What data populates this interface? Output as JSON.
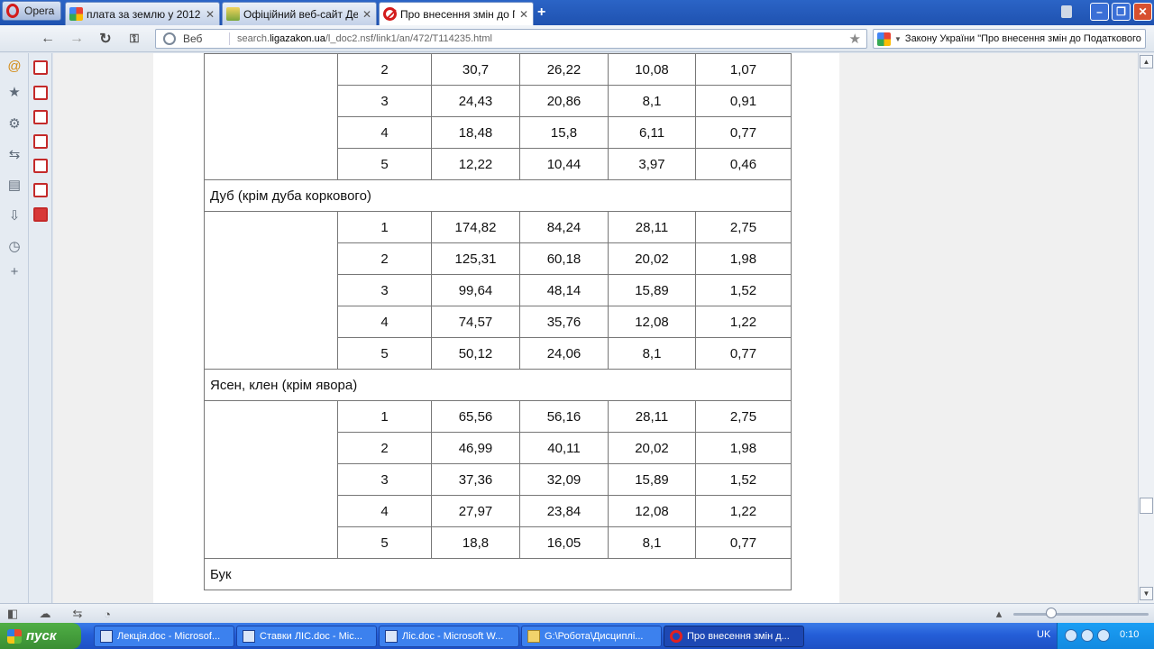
{
  "browser": {
    "menu_label": "Opera",
    "tabs": [
      {
        "label": "плата за землю у 2012 ...",
        "active": false,
        "icon": "google-favicon"
      },
      {
        "label": "Офіційний веб-сайт Де...",
        "active": false,
        "icon": "crest-favicon"
      },
      {
        "label": "Про внесення змін до П...",
        "active": true,
        "icon": "ban-favicon"
      }
    ],
    "new_tab": "+",
    "address": {
      "scheme_label": "Веб",
      "url_prefix": "search.",
      "url_domain": "ligazakon.ua",
      "url_path": "/l_doc2.nsf/link1/an/472/T114235.html"
    },
    "search_text": "Закону України \"Про внесення змін до Податкового"
  },
  "table": {
    "rows": [
      {
        "kind": "data",
        "cells": [
          "2",
          "30,7",
          "26,22",
          "10,08",
          "1,07"
        ]
      },
      {
        "kind": "data",
        "cells": [
          "3",
          "24,43",
          "20,86",
          "8,1",
          "0,91"
        ]
      },
      {
        "kind": "data",
        "cells": [
          "4",
          "18,48",
          "15,8",
          "6,11",
          "0,77"
        ]
      },
      {
        "kind": "data",
        "cells": [
          "5",
          "12,22",
          "10,44",
          "3,97",
          "0,46"
        ]
      },
      {
        "kind": "species",
        "label": "Дуб (крім дуба коркового)"
      },
      {
        "kind": "data",
        "cells": [
          "1",
          "174,82",
          "84,24",
          "28,11",
          "2,75"
        ]
      },
      {
        "kind": "data",
        "cells": [
          "2",
          "125,31",
          "60,18",
          "20,02",
          "1,98"
        ]
      },
      {
        "kind": "data",
        "cells": [
          "3",
          "99,64",
          "48,14",
          "15,89",
          "1,52"
        ]
      },
      {
        "kind": "data",
        "cells": [
          "4",
          "74,57",
          "35,76",
          "12,08",
          "1,22"
        ]
      },
      {
        "kind": "data",
        "cells": [
          "5",
          "50,12",
          "24,06",
          "8,1",
          "0,77"
        ]
      },
      {
        "kind": "species",
        "label": "Ясен, клен (крім явора)"
      },
      {
        "kind": "data",
        "cells": [
          "1",
          "65,56",
          "56,16",
          "28,11",
          "2,75"
        ]
      },
      {
        "kind": "data",
        "cells": [
          "2",
          "46,99",
          "40,11",
          "20,02",
          "1,98"
        ]
      },
      {
        "kind": "data",
        "cells": [
          "3",
          "37,36",
          "32,09",
          "15,89",
          "1,52"
        ]
      },
      {
        "kind": "data",
        "cells": [
          "4",
          "27,97",
          "23,84",
          "12,08",
          "1,22"
        ]
      },
      {
        "kind": "data",
        "cells": [
          "5",
          "18,8",
          "16,05",
          "8,1",
          "0,77"
        ]
      },
      {
        "kind": "species",
        "label": "Бук"
      }
    ]
  },
  "taskbar": {
    "start_label": "пуск",
    "tasks": [
      {
        "label": "Лекція.doc - Microsof...",
        "icon": "word-doc-icon",
        "active": false
      },
      {
        "label": "Ставки ЛІС.doc - Mic...",
        "icon": "word-doc-icon",
        "active": false
      },
      {
        "label": "Ліс.doc - Microsoft W...",
        "icon": "word-doc-icon",
        "active": false
      },
      {
        "label": "G:\\Робота\\Дисциплі...",
        "icon": "folder-icon",
        "active": false
      },
      {
        "label": "Про внесення змін д...",
        "icon": "opera-icon",
        "active": true
      }
    ],
    "language": "UK",
    "clock": "0:10"
  }
}
